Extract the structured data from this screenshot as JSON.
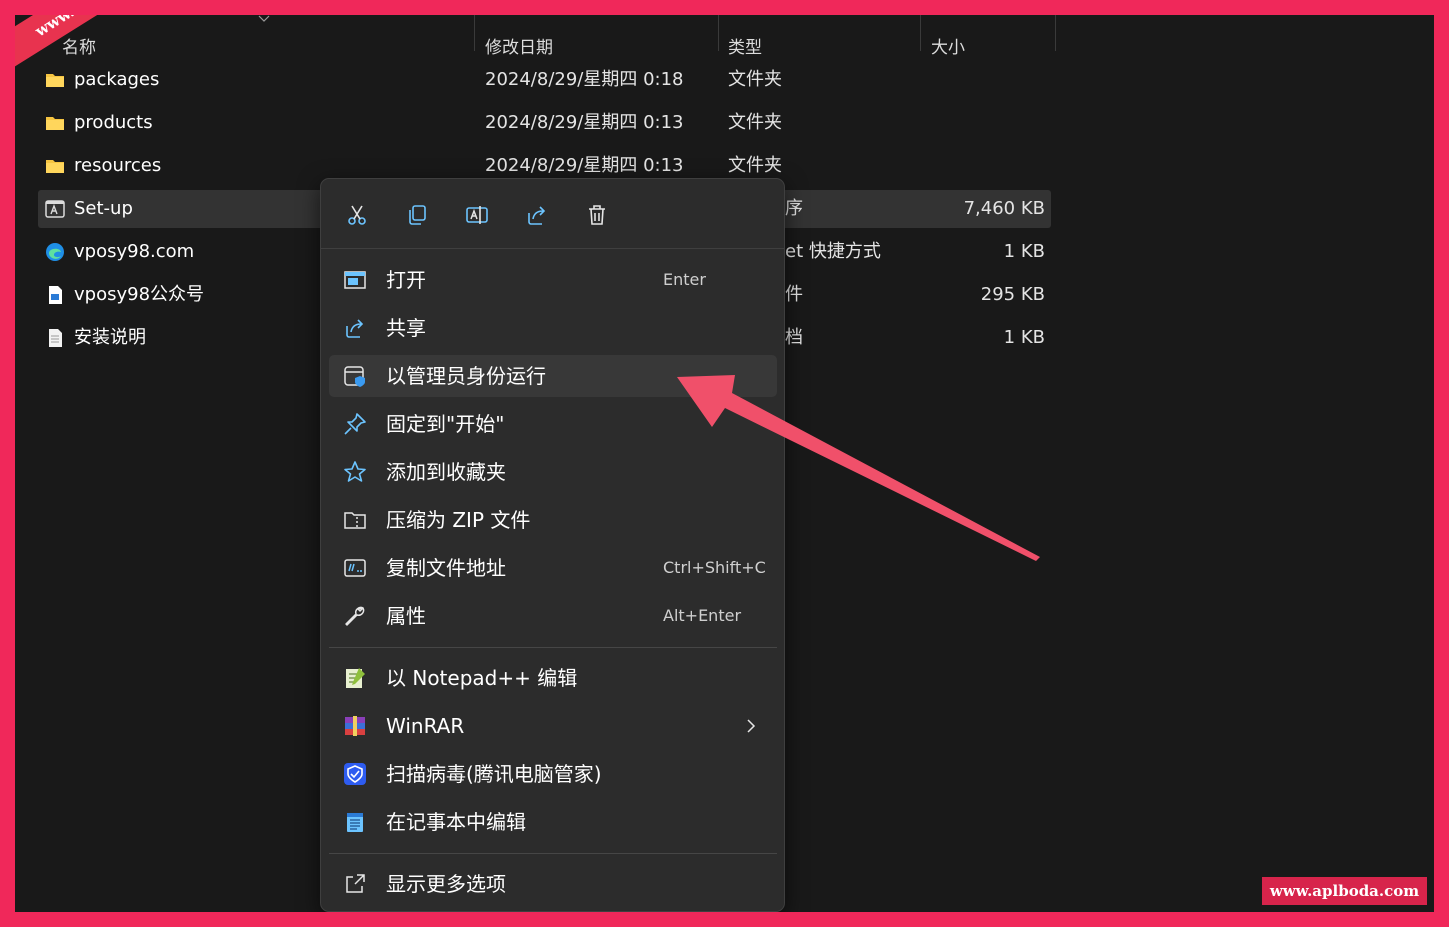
{
  "columns": {
    "name": "名称",
    "date": "修改日期",
    "type": "类型",
    "size": "大小"
  },
  "files": [
    {
      "name": "packages",
      "date": "2024/8/29/星期四 0:18",
      "type": "文件夹",
      "size": "",
      "icon": "folder-icon"
    },
    {
      "name": "products",
      "date": "2024/8/29/星期四 0:13",
      "type": "文件夹",
      "size": "",
      "icon": "folder-icon"
    },
    {
      "name": "resources",
      "date": "2024/8/29/星期四 0:13",
      "type": "文件夹",
      "size": "",
      "icon": "folder-icon"
    },
    {
      "name": "Set-up",
      "date": "",
      "type": "序",
      "size": "7,460 KB",
      "icon": "adobe-app-icon"
    },
    {
      "name": "vposy98.com",
      "date": "",
      "type": "et 快捷方式",
      "size": "1 KB",
      "icon": "edge-icon"
    },
    {
      "name": "vposy98公众号",
      "date": "",
      "type": "件",
      "size": "295 KB",
      "icon": "image-file-icon"
    },
    {
      "name": "安装说明",
      "date": "",
      "type": "档",
      "size": "1 KB",
      "icon": "text-file-icon"
    }
  ],
  "menu": {
    "toolbar": [
      "cut-icon",
      "copy-icon",
      "rename-icon",
      "share-icon",
      "delete-icon"
    ],
    "items": [
      {
        "label": "打开",
        "shortcut": "Enter",
        "icon": "open-icon"
      },
      {
        "label": "共享",
        "shortcut": "",
        "icon": "share-icon"
      },
      {
        "label": "以管理员身份运行",
        "shortcut": "",
        "icon": "admin-shield-icon"
      },
      {
        "label": "固定到\"开始\"",
        "shortcut": "",
        "icon": "pin-icon"
      },
      {
        "label": "添加到收藏夹",
        "shortcut": "",
        "icon": "star-icon"
      },
      {
        "label": "压缩为 ZIP 文件",
        "shortcut": "",
        "icon": "zip-folder-icon"
      },
      {
        "label": "复制文件地址",
        "shortcut": "Ctrl+Shift+C",
        "icon": "copy-path-icon"
      },
      {
        "label": "属性",
        "shortcut": "Alt+Enter",
        "icon": "wrench-icon"
      }
    ],
    "extra_items": [
      {
        "label": "以 Notepad++ 编辑",
        "icon": "notepadpp-icon"
      },
      {
        "label": "WinRAR",
        "icon": "winrar-icon"
      },
      {
        "label": "扫描病毒(腾讯电脑管家)",
        "icon": "tencent-shield-icon"
      },
      {
        "label": "在记事本中编辑",
        "icon": "notepad-icon"
      }
    ],
    "more": {
      "label": "显示更多选项",
      "icon": "more-options-icon"
    }
  },
  "watermark": {
    "corner": "www.aplboda.com",
    "badge": "www.aplboda.com"
  },
  "colors": {
    "frame": "#f0285a",
    "background": "#191919",
    "menu": "#2c2c2c",
    "arrow": "#f0506a",
    "folder": "#f5c441"
  }
}
